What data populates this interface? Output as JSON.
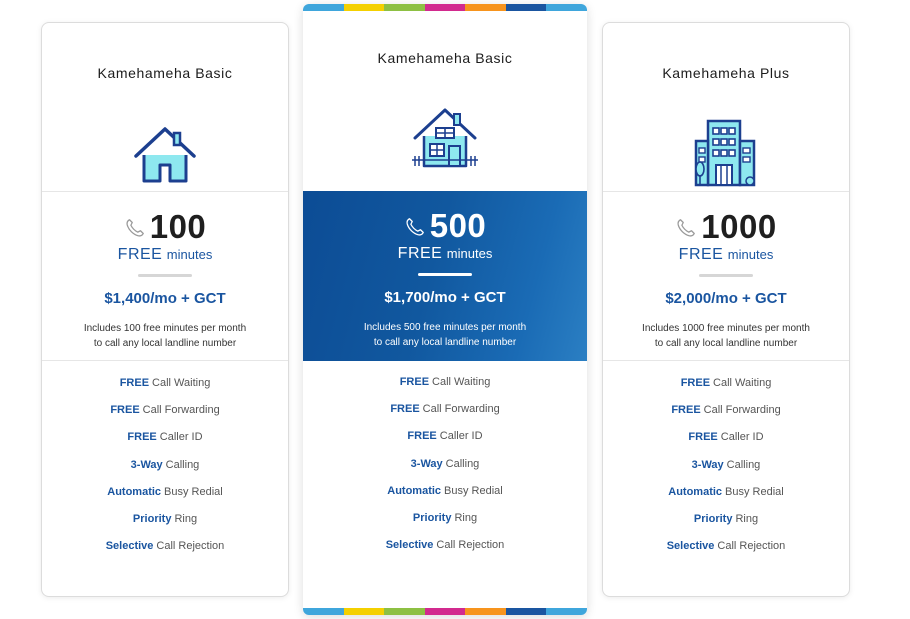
{
  "colors": {
    "accent": "#1a55a0",
    "featured_gradient_start": "#0c4c95",
    "featured_gradient_end": "#2b7fc3",
    "icon_fill": "#8ee8ef",
    "icon_stroke": "#1c3f8f",
    "stripe": [
      "#3fa6dc",
      "#f4d000",
      "#8dc043",
      "#d22a8e",
      "#f7941d",
      "#1a55a0",
      "#3fa6dc"
    ]
  },
  "plans": [
    {
      "name": "Kamehameha Basic",
      "icon": "house-outline-icon",
      "minutes": "100",
      "free_label": "FREE",
      "minutes_label": "minutes",
      "price": "$1,400/mo + GCT",
      "desc_line1": "Includes 100 free minutes per month",
      "desc_line2": "to call any local landline number",
      "featured": false
    },
    {
      "name": "Kamehameha Basic",
      "icon": "house-detailed-icon",
      "minutes": "500",
      "free_label": "FREE",
      "minutes_label": "minutes",
      "price": "$1,700/mo + GCT",
      "desc_line1": "Includes 500 free minutes per month",
      "desc_line2": "to call any local landline number",
      "featured": true
    },
    {
      "name": "Kamehameha Plus",
      "icon": "office-building-icon",
      "minutes": "1000",
      "free_label": "FREE",
      "minutes_label": "minutes",
      "price": "$2,000/mo + GCT",
      "desc_line1": "Includes 1000 free minutes per month",
      "desc_line2": "to call any local landline number",
      "featured": false
    }
  ],
  "features": [
    {
      "bold": "FREE",
      "text": "Call Waiting"
    },
    {
      "bold": "FREE",
      "text": "Call Forwarding"
    },
    {
      "bold": "FREE",
      "text": "Caller ID"
    },
    {
      "bold": "3-Way",
      "text": "Calling"
    },
    {
      "bold": "Automatic",
      "text": "Busy Redial"
    },
    {
      "bold": "Priority",
      "text": "Ring"
    },
    {
      "bold": "Selective",
      "text": "Call Rejection"
    }
  ]
}
